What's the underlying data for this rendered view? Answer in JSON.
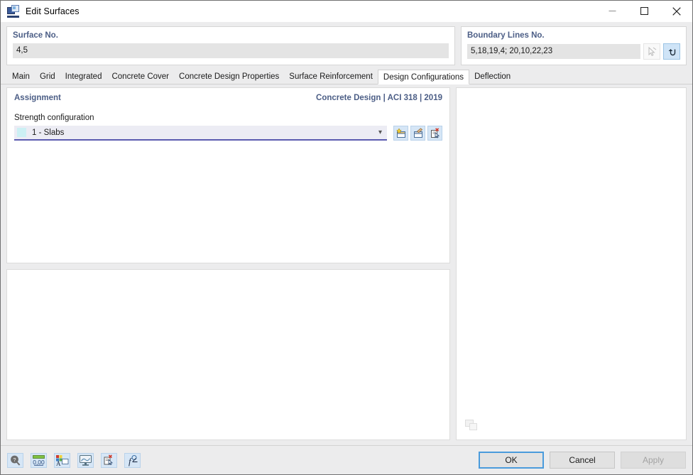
{
  "window": {
    "title": "Edit Surfaces",
    "icon": "surfaces-icon",
    "controls": {
      "minimize": "minimize-icon",
      "maximize": "maximize-icon",
      "close": "close-icon"
    }
  },
  "numbers": {
    "surface": {
      "label": "Surface No.",
      "value": "4,5",
      "placeholder": ""
    },
    "boundary": {
      "label": "Boundary Lines No.",
      "value": "5,18,19,4; 20,10,22,23",
      "placeholder": "",
      "buttons": [
        {
          "name": "pick-boundary-lines-button",
          "icon": "select-cursor-icon",
          "enabled": false
        },
        {
          "name": "reverse-boundary-lines-button",
          "icon": "return-arrow-icon",
          "enabled": true
        }
      ]
    }
  },
  "tabs": [
    {
      "label": "Main",
      "active": false
    },
    {
      "label": "Grid",
      "active": false
    },
    {
      "label": "Integrated",
      "active": false
    },
    {
      "label": "Concrete Cover",
      "active": false
    },
    {
      "label": "Concrete Design Properties",
      "active": false
    },
    {
      "label": "Surface Reinforcement",
      "active": false
    },
    {
      "label": "Design Configurations",
      "active": true
    },
    {
      "label": "Deflection",
      "active": false
    }
  ],
  "assignment": {
    "title": "Assignment",
    "standard": "Concrete Design | ACI 318 | 2019",
    "field_label": "Strength configuration",
    "combo_value": "1 - Slabs",
    "combo_swatch_color": "#ccf0f4",
    "combo_icons": [
      {
        "name": "new-configuration-button",
        "icon": "new-item-icon"
      },
      {
        "name": "edit-configuration-button",
        "icon": "edit-item-icon"
      },
      {
        "name": "delete-configuration-button",
        "icon": "delete-item-icon"
      }
    ]
  },
  "right_panel": {
    "badge_icon": "preview-thumbnail-icon"
  },
  "footer": {
    "tools": [
      {
        "name": "help-button",
        "icon": "help-magnifier-icon"
      },
      {
        "name": "number-format-button",
        "icon": "decimal-places-icon",
        "label": "0,00"
      },
      {
        "name": "display-properties-button",
        "icon": "text-style-icon"
      },
      {
        "name": "view-settings-button",
        "icon": "monitor-icon"
      },
      {
        "name": "clear-selection-button",
        "icon": "delete-list-icon"
      },
      {
        "name": "formula-button",
        "icon": "function-icon",
        "label": "f"
      }
    ],
    "buttons": {
      "ok": "OK",
      "cancel": "Cancel",
      "apply": "Apply"
    }
  },
  "colors": {
    "accent_blue": "#4c5e86",
    "focus_blue": "#4a9bdc",
    "icon_button_bg": "#d6e6f6",
    "combo_underline": "#5b5bb0"
  }
}
